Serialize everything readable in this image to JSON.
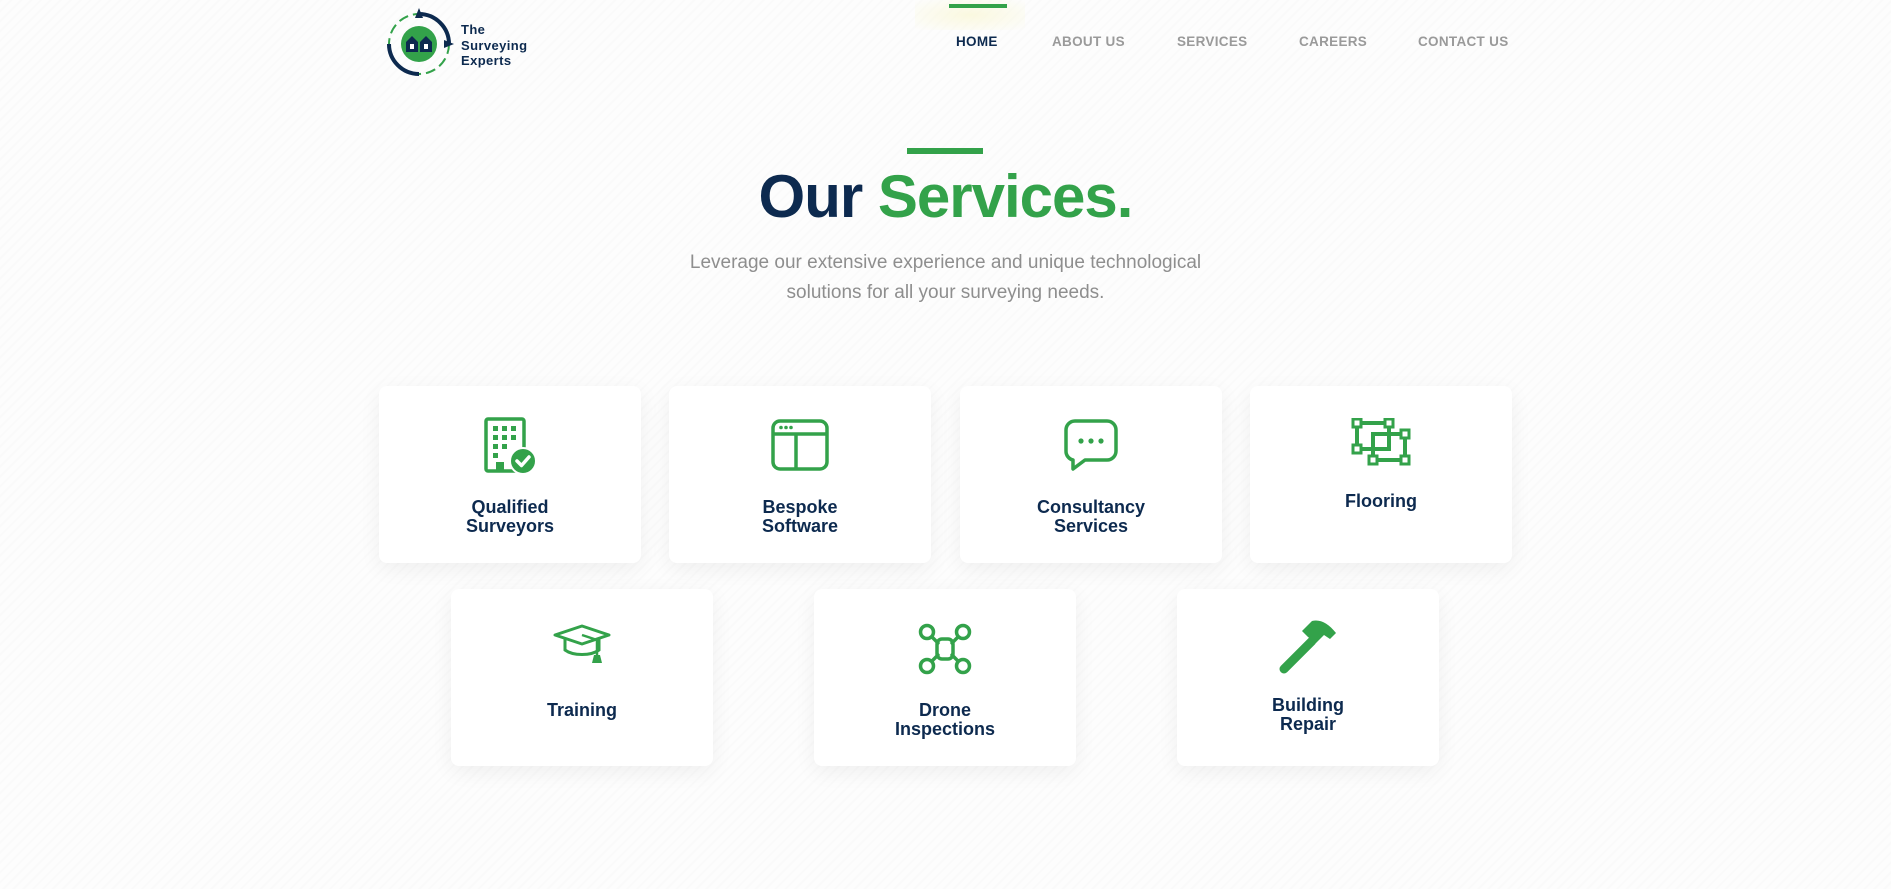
{
  "header": {
    "logo_lines": [
      "The",
      "Surveying",
      "Experts"
    ],
    "nav": [
      {
        "label": "HOME",
        "active": true
      },
      {
        "label": "ABOUT US",
        "active": false
      },
      {
        "label": "SERVICES",
        "active": false
      },
      {
        "label": "CAREERS",
        "active": false
      },
      {
        "label": "CONTACT US",
        "active": false
      }
    ]
  },
  "hero": {
    "title_part1": "Our",
    "title_part2": "Services.",
    "subtitle_line1": "Leverage our extensive experience and unique technological",
    "subtitle_line2": "solutions for all your surveying needs."
  },
  "services": [
    {
      "icon": "building-check-icon",
      "line1": "Qualified",
      "line2": "Surveyors"
    },
    {
      "icon": "browser-window-icon",
      "line1": "Bespoke",
      "line2": "Software"
    },
    {
      "icon": "chat-bubble-icon",
      "line1": "Consultancy",
      "line2": "Services"
    },
    {
      "icon": "floor-plan-icon",
      "line1": "Flooring",
      "line2": ""
    },
    {
      "icon": "graduation-cap-icon",
      "line1": "Training",
      "line2": ""
    },
    {
      "icon": "drone-icon",
      "line1": "Drone",
      "line2": "Inspections"
    },
    {
      "icon": "hammer-icon",
      "line1": "Building",
      "line2": "Repair"
    }
  ],
  "colors": {
    "navy": "#0d2a4f",
    "green": "#33a24a",
    "muted": "#9a9a9a"
  }
}
